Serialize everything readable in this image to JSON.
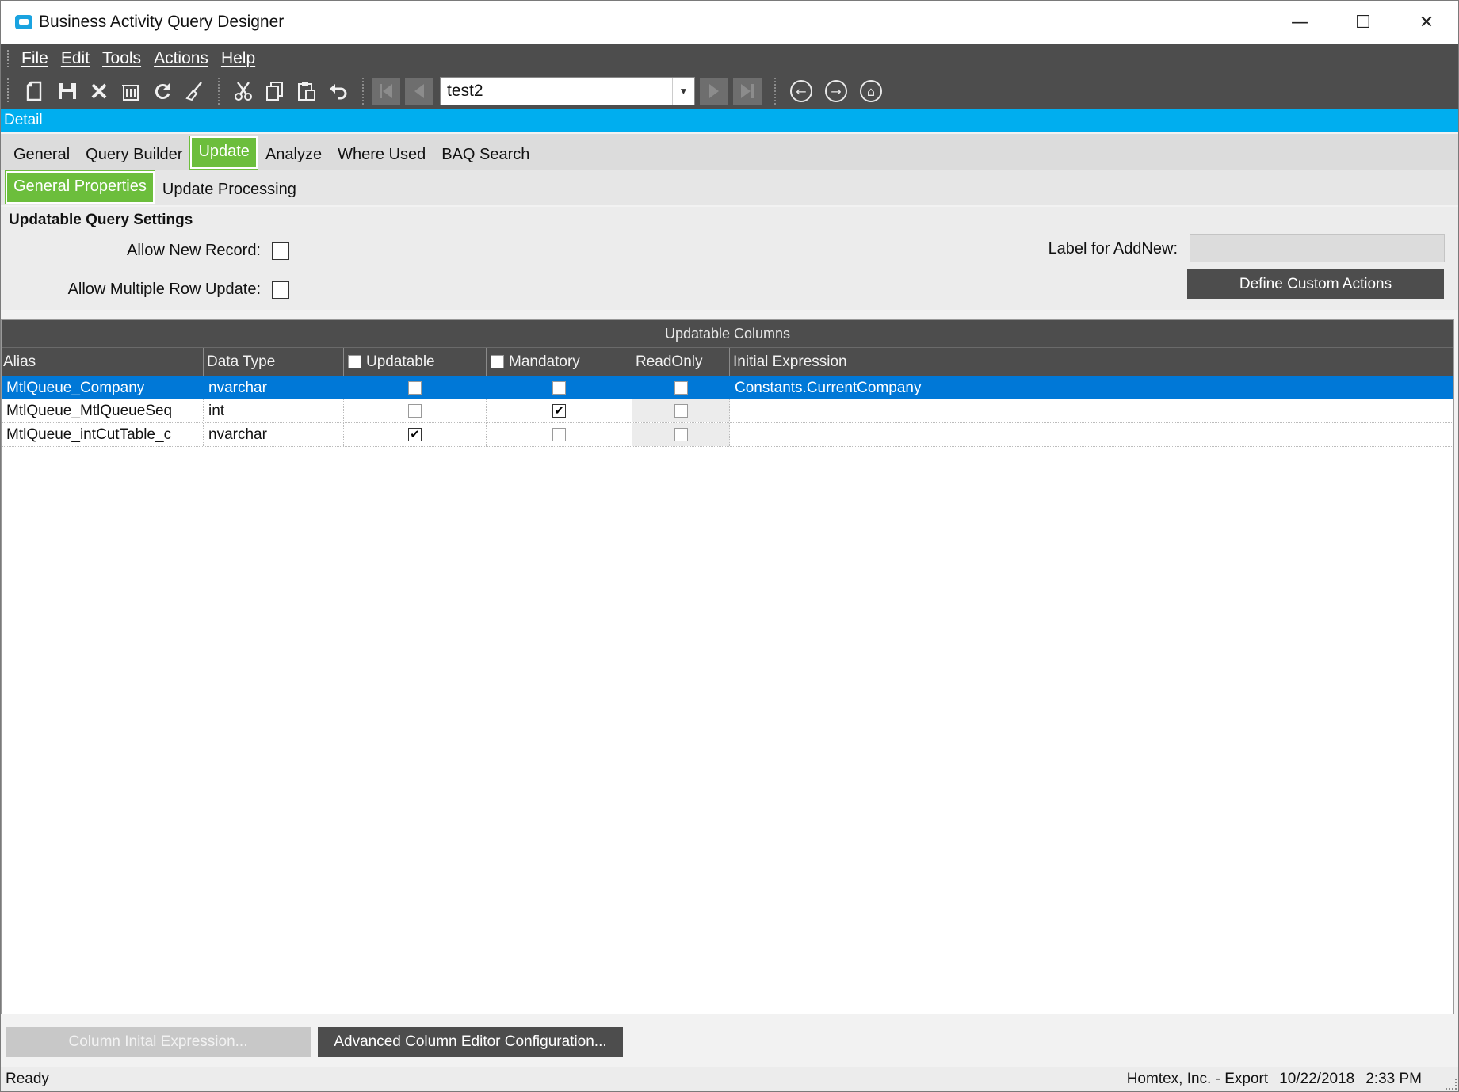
{
  "window": {
    "title": "Business Activity Query Designer",
    "controls": {
      "minimize": "—",
      "maximize": "☐",
      "close": "✕"
    }
  },
  "menu": [
    "File",
    "Edit",
    "Tools",
    "Actions",
    "Help"
  ],
  "toolbar": {
    "icons": [
      "new-icon",
      "save-icon",
      "delete-icon",
      "clear-icon",
      "refresh-icon",
      "broom-icon",
      "cut-icon",
      "copy-icon",
      "paste-icon",
      "undo-icon"
    ],
    "record_value": "test2",
    "nav_icons": [
      "back-icon",
      "forward-icon",
      "home-icon"
    ]
  },
  "detail_bar": {
    "label": "Detail"
  },
  "tabs": [
    "General",
    "Query Builder",
    "Update",
    "Analyze",
    "Where Used",
    "BAQ Search"
  ],
  "active_tab": "Update",
  "subtabs": [
    "General Properties",
    "Update Processing"
  ],
  "active_subtab": "General Properties",
  "settings": {
    "title": "Updatable Query Settings",
    "allow_new_record_label": "Allow New Record:",
    "allow_new_record": false,
    "allow_multiple_row_label": "Allow Multiple Row Update:",
    "allow_multiple_row": false,
    "label_for_addnew_label": "Label for AddNew:",
    "label_for_addnew_value": "",
    "define_custom_actions": "Define Custom Actions"
  },
  "grid": {
    "caption": "Updatable Columns",
    "columns": [
      "Alias",
      "Data Type",
      "Updatable",
      "Mandatory",
      "ReadOnly",
      "Initial Expression"
    ],
    "rows": [
      {
        "alias": "MtlQueue_Company",
        "data_type": "nvarchar",
        "updatable": false,
        "mandatory": false,
        "readonly": false,
        "initial_expression": "Constants.CurrentCompany",
        "selected": true
      },
      {
        "alias": "MtlQueue_MtlQueueSeq",
        "data_type": "int",
        "updatable": false,
        "mandatory": true,
        "readonly": false,
        "initial_expression": "",
        "selected": false
      },
      {
        "alias": "MtlQueue_intCutTable_c",
        "data_type": "nvarchar",
        "updatable": true,
        "mandatory": false,
        "readonly": false,
        "initial_expression": "",
        "selected": false
      }
    ]
  },
  "buttons": {
    "column_initial_expression": "Column Inital Expression...",
    "advanced_column_editor": "Advanced Column Editor Configuration..."
  },
  "status": {
    "left": "Ready",
    "company": "Homtex, Inc. - Export",
    "date": "10/22/2018",
    "time": "2:33 PM"
  },
  "colors": {
    "accent": "#00aeef",
    "active_tab": "#6cbe3c",
    "selection": "#0078d7",
    "dark": "#4d4d4d"
  }
}
